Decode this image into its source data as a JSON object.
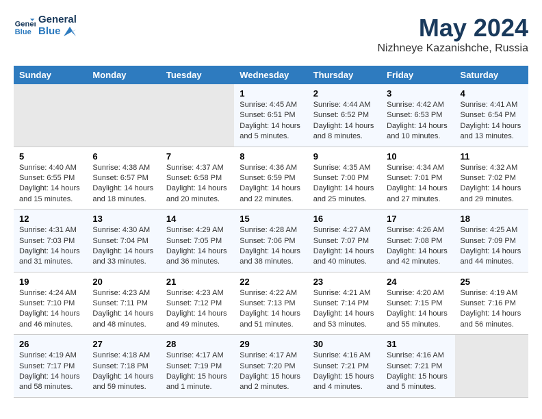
{
  "header": {
    "logo_line1": "General",
    "logo_line2": "Blue",
    "month_year": "May 2024",
    "location": "Nizhneye Kazanishche, Russia"
  },
  "weekdays": [
    "Sunday",
    "Monday",
    "Tuesday",
    "Wednesday",
    "Thursday",
    "Friday",
    "Saturday"
  ],
  "weeks": [
    [
      {
        "day": "",
        "info": ""
      },
      {
        "day": "",
        "info": ""
      },
      {
        "day": "",
        "info": ""
      },
      {
        "day": "1",
        "info": "Sunrise: 4:45 AM\nSunset: 6:51 PM\nDaylight: 14 hours\nand 5 minutes."
      },
      {
        "day": "2",
        "info": "Sunrise: 4:44 AM\nSunset: 6:52 PM\nDaylight: 14 hours\nand 8 minutes."
      },
      {
        "day": "3",
        "info": "Sunrise: 4:42 AM\nSunset: 6:53 PM\nDaylight: 14 hours\nand 10 minutes."
      },
      {
        "day": "4",
        "info": "Sunrise: 4:41 AM\nSunset: 6:54 PM\nDaylight: 14 hours\nand 13 minutes."
      }
    ],
    [
      {
        "day": "5",
        "info": "Sunrise: 4:40 AM\nSunset: 6:55 PM\nDaylight: 14 hours\nand 15 minutes."
      },
      {
        "day": "6",
        "info": "Sunrise: 4:38 AM\nSunset: 6:57 PM\nDaylight: 14 hours\nand 18 minutes."
      },
      {
        "day": "7",
        "info": "Sunrise: 4:37 AM\nSunset: 6:58 PM\nDaylight: 14 hours\nand 20 minutes."
      },
      {
        "day": "8",
        "info": "Sunrise: 4:36 AM\nSunset: 6:59 PM\nDaylight: 14 hours\nand 22 minutes."
      },
      {
        "day": "9",
        "info": "Sunrise: 4:35 AM\nSunset: 7:00 PM\nDaylight: 14 hours\nand 25 minutes."
      },
      {
        "day": "10",
        "info": "Sunrise: 4:34 AM\nSunset: 7:01 PM\nDaylight: 14 hours\nand 27 minutes."
      },
      {
        "day": "11",
        "info": "Sunrise: 4:32 AM\nSunset: 7:02 PM\nDaylight: 14 hours\nand 29 minutes."
      }
    ],
    [
      {
        "day": "12",
        "info": "Sunrise: 4:31 AM\nSunset: 7:03 PM\nDaylight: 14 hours\nand 31 minutes."
      },
      {
        "day": "13",
        "info": "Sunrise: 4:30 AM\nSunset: 7:04 PM\nDaylight: 14 hours\nand 33 minutes."
      },
      {
        "day": "14",
        "info": "Sunrise: 4:29 AM\nSunset: 7:05 PM\nDaylight: 14 hours\nand 36 minutes."
      },
      {
        "day": "15",
        "info": "Sunrise: 4:28 AM\nSunset: 7:06 PM\nDaylight: 14 hours\nand 38 minutes."
      },
      {
        "day": "16",
        "info": "Sunrise: 4:27 AM\nSunset: 7:07 PM\nDaylight: 14 hours\nand 40 minutes."
      },
      {
        "day": "17",
        "info": "Sunrise: 4:26 AM\nSunset: 7:08 PM\nDaylight: 14 hours\nand 42 minutes."
      },
      {
        "day": "18",
        "info": "Sunrise: 4:25 AM\nSunset: 7:09 PM\nDaylight: 14 hours\nand 44 minutes."
      }
    ],
    [
      {
        "day": "19",
        "info": "Sunrise: 4:24 AM\nSunset: 7:10 PM\nDaylight: 14 hours\nand 46 minutes."
      },
      {
        "day": "20",
        "info": "Sunrise: 4:23 AM\nSunset: 7:11 PM\nDaylight: 14 hours\nand 48 minutes."
      },
      {
        "day": "21",
        "info": "Sunrise: 4:23 AM\nSunset: 7:12 PM\nDaylight: 14 hours\nand 49 minutes."
      },
      {
        "day": "22",
        "info": "Sunrise: 4:22 AM\nSunset: 7:13 PM\nDaylight: 14 hours\nand 51 minutes."
      },
      {
        "day": "23",
        "info": "Sunrise: 4:21 AM\nSunset: 7:14 PM\nDaylight: 14 hours\nand 53 minutes."
      },
      {
        "day": "24",
        "info": "Sunrise: 4:20 AM\nSunset: 7:15 PM\nDaylight: 14 hours\nand 55 minutes."
      },
      {
        "day": "25",
        "info": "Sunrise: 4:19 AM\nSunset: 7:16 PM\nDaylight: 14 hours\nand 56 minutes."
      }
    ],
    [
      {
        "day": "26",
        "info": "Sunrise: 4:19 AM\nSunset: 7:17 PM\nDaylight: 14 hours\nand 58 minutes."
      },
      {
        "day": "27",
        "info": "Sunrise: 4:18 AM\nSunset: 7:18 PM\nDaylight: 14 hours\nand 59 minutes."
      },
      {
        "day": "28",
        "info": "Sunrise: 4:17 AM\nSunset: 7:19 PM\nDaylight: 15 hours\nand 1 minute."
      },
      {
        "day": "29",
        "info": "Sunrise: 4:17 AM\nSunset: 7:20 PM\nDaylight: 15 hours\nand 2 minutes."
      },
      {
        "day": "30",
        "info": "Sunrise: 4:16 AM\nSunset: 7:21 PM\nDaylight: 15 hours\nand 4 minutes."
      },
      {
        "day": "31",
        "info": "Sunrise: 4:16 AM\nSunset: 7:21 PM\nDaylight: 15 hours\nand 5 minutes."
      },
      {
        "day": "",
        "info": ""
      }
    ]
  ]
}
